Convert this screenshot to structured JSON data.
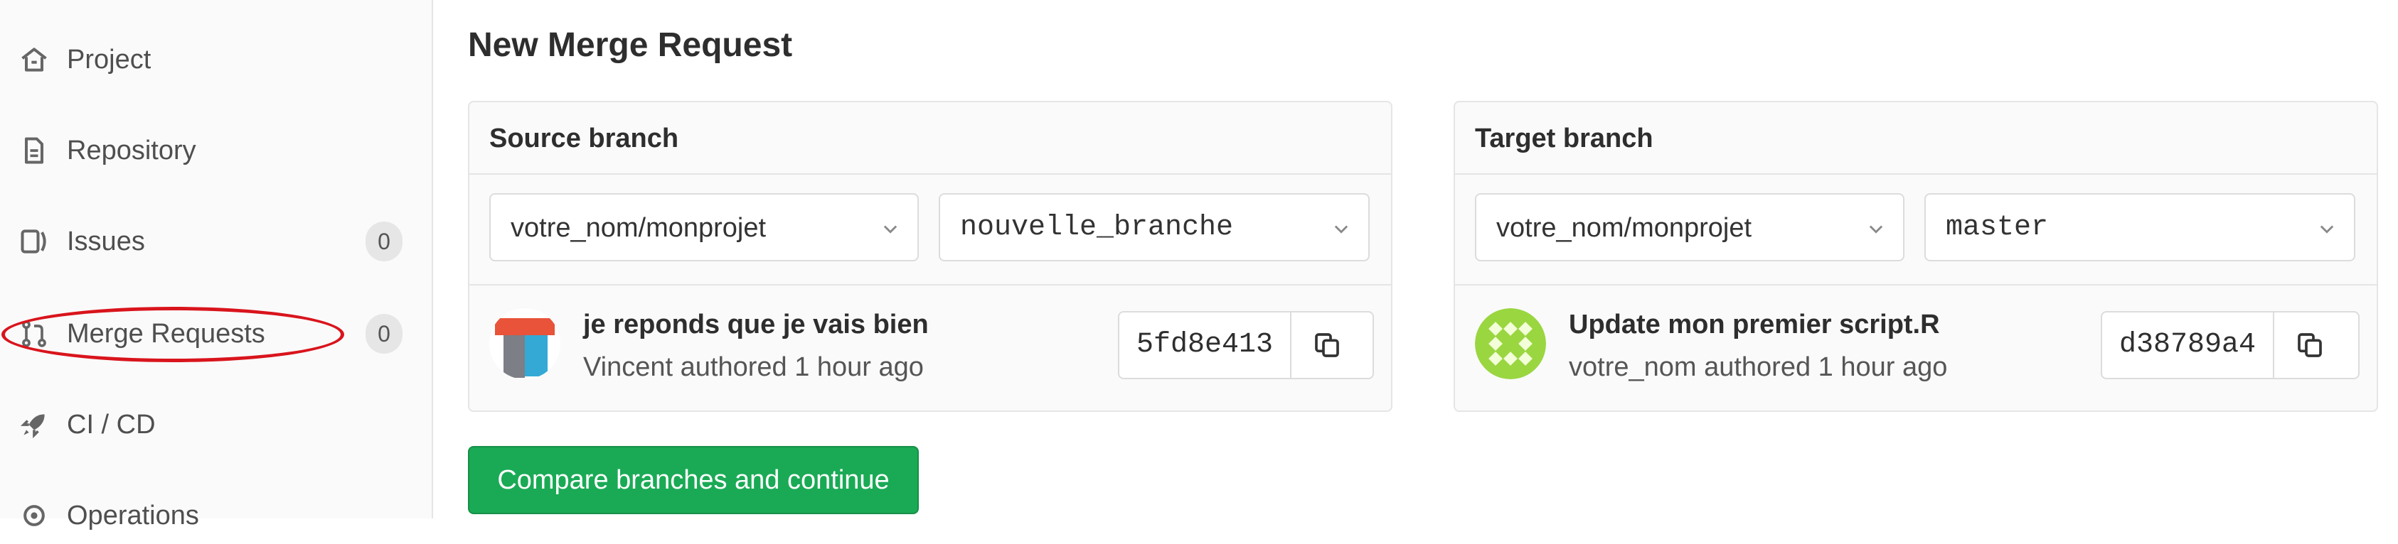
{
  "sidebar": {
    "items": [
      {
        "label": "Project",
        "icon": "home-icon"
      },
      {
        "label": "Repository",
        "icon": "document-icon"
      },
      {
        "label": "Issues",
        "icon": "issues-icon",
        "count": "0"
      },
      {
        "label": "Merge Requests",
        "icon": "merge-request-icon",
        "count": "0"
      },
      {
        "label": "CI / CD",
        "icon": "rocket-icon"
      },
      {
        "label": "Operations",
        "icon": "operations-icon"
      }
    ]
  },
  "main": {
    "title": "New Merge Request",
    "source": {
      "header": "Source branch",
      "project": "votre_nom/monprojet",
      "branch": "nouvelle_branche",
      "commit_title": "je reponds que je vais bien",
      "commit_meta": "Vincent authored 1 hour ago",
      "sha": "5fd8e413"
    },
    "target": {
      "header": "Target branch",
      "project": "votre_nom/monprojet",
      "branch": "master",
      "commit_title": "Update mon premier script.R",
      "commit_meta": "votre_nom authored 1 hour ago",
      "sha": "d38789a4"
    },
    "compare_button": "Compare branches and continue"
  },
  "colors": {
    "accent_green": "#1aaa55",
    "highlight_red": "#d9141c"
  }
}
